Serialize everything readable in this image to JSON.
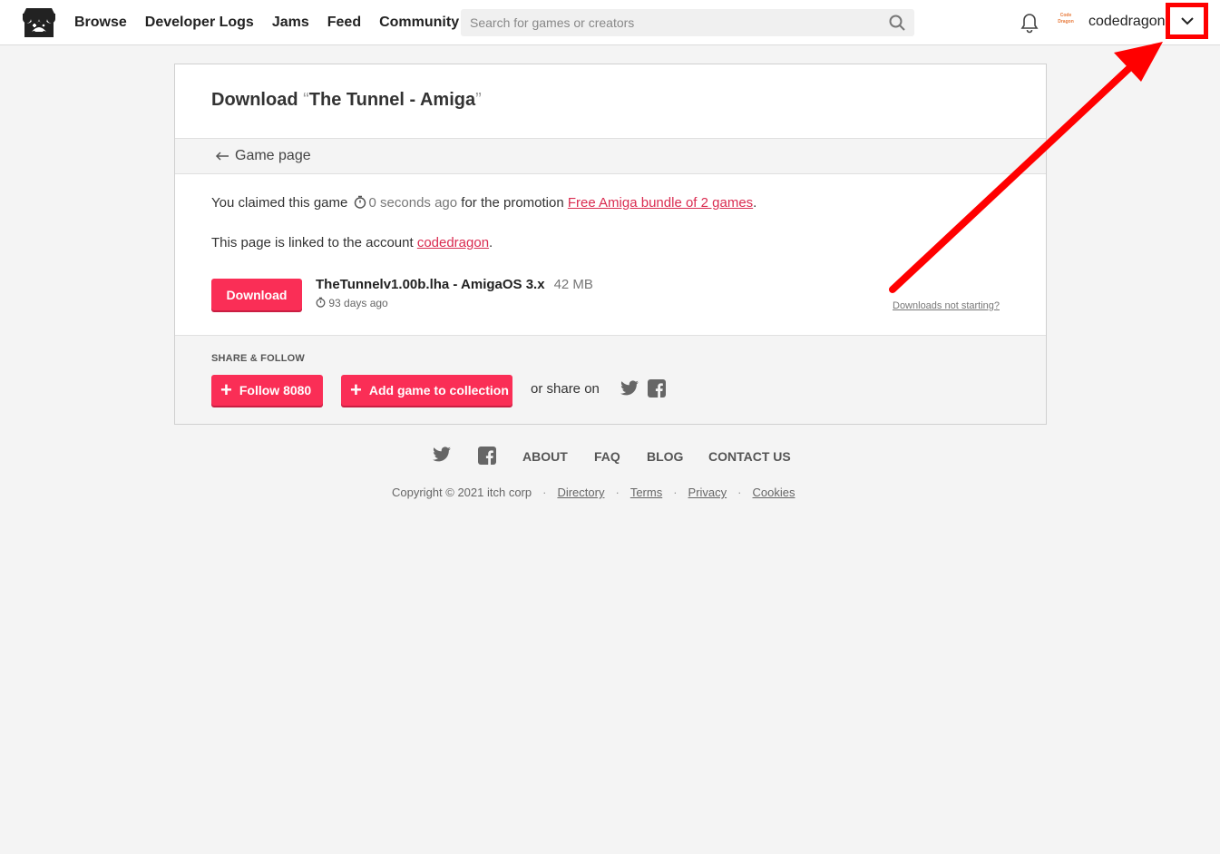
{
  "header": {
    "nav": [
      "Browse",
      "Developer Logs",
      "Jams",
      "Feed",
      "Community"
    ],
    "search_placeholder": "Search for games or creators",
    "username": "codedragon",
    "avatar_text": "Code Dragon"
  },
  "card": {
    "title_prefix": "Download ",
    "quote_open": "“",
    "game_title": "The Tunnel - Amiga",
    "quote_close": "”",
    "back_label": "Game page",
    "claim_prefix": "You claimed this game",
    "claim_time": "0 seconds ago",
    "claim_mid": "for the promotion",
    "promo_link": "Free Amiga bundle of 2 games",
    "claim_end": ".",
    "linked_prefix": "This page is linked to the account",
    "linked_account": "codedragon",
    "linked_end": ".",
    "download_label": "Download",
    "file_name": "TheTunnelv1.00b.lha - AmigaOS 3.x",
    "file_size": "42 MB",
    "file_date": "93 days ago",
    "not_starting": "Downloads not starting?",
    "share_label": "SHARE & FOLLOW",
    "follow_label": "Follow 8080",
    "collection_label": "Add game to collection",
    "share_text": "or share on"
  },
  "footer": {
    "links": [
      "ABOUT",
      "FAQ",
      "BLOG",
      "CONTACT US"
    ],
    "copyright": "Copyright © 2021 itch corp",
    "legal": [
      "Directory",
      "Terms",
      "Privacy",
      "Cookies"
    ]
  },
  "colors": {
    "accent": "#fa2e56",
    "link": "#da2c51",
    "annotation": "#ff0000"
  }
}
